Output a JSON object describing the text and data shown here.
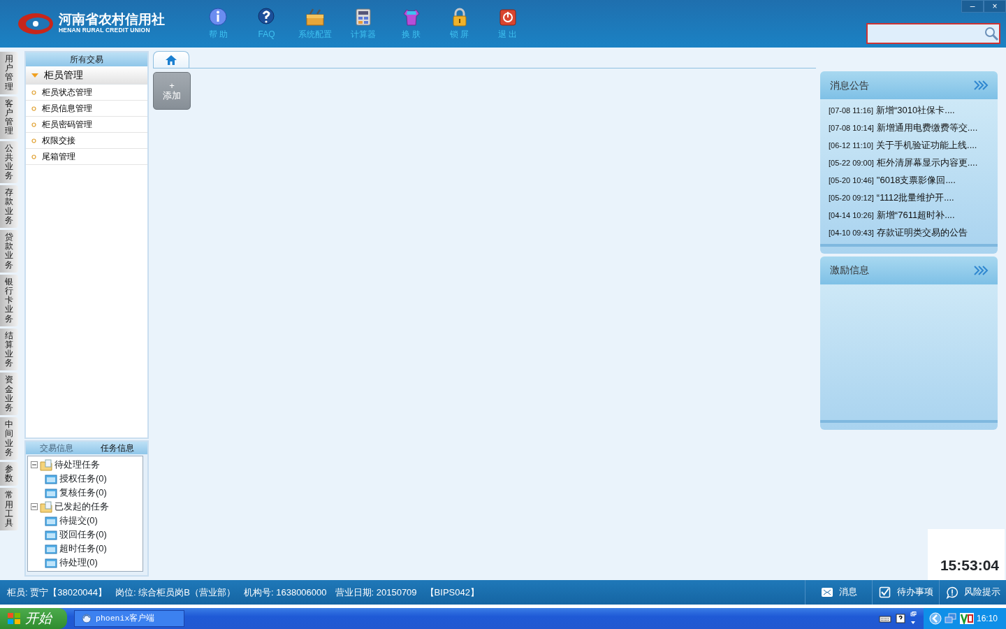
{
  "app": {
    "logo_title": "河南省农村信用社",
    "logo_subtitle": "HENAN RURAL CREDIT UNION"
  },
  "toolbar": [
    {
      "label": "帮 助",
      "kind": "info"
    },
    {
      "label": "FAQ",
      "kind": "question"
    },
    {
      "label": "系统配置",
      "kind": "toolbox"
    },
    {
      "label": "计算器",
      "kind": "calculator"
    },
    {
      "label": "换 肤",
      "kind": "shirt"
    },
    {
      "label": "锁 屏",
      "kind": "lock"
    },
    {
      "label": "退 出",
      "kind": "power"
    }
  ],
  "window_controls": [
    "–",
    "×"
  ],
  "side_tabs": [
    {
      "label": "用户管理"
    },
    {
      "label": "客户管理"
    },
    {
      "label": "公共业务"
    },
    {
      "label": "存款业务"
    },
    {
      "label": "贷款业务"
    },
    {
      "label": "银行卡业务"
    },
    {
      "label": "结算业务"
    },
    {
      "label": "资金业务"
    },
    {
      "label": "中间业务"
    },
    {
      "label": "参数"
    },
    {
      "label": "常用工具"
    }
  ],
  "nav": {
    "title": "所有交易",
    "group": {
      "label": "柜员管理",
      "expanded": true,
      "items": [
        "柜员状态管理",
        "柜员信息管理",
        "柜员密码管理",
        "权限交接",
        "尾箱管理"
      ]
    }
  },
  "info_tabs": [
    {
      "label": "交易信息",
      "selected": false
    },
    {
      "label": "任务信息",
      "selected": true
    }
  ],
  "task_tree": [
    {
      "label": "待处理任务",
      "expanded": true,
      "children": [
        {
          "label": "授权任务(0)"
        },
        {
          "label": "复核任务(0)"
        }
      ]
    },
    {
      "label": "已发起的任务",
      "expanded": true,
      "children": [
        {
          "label": "待提交(0)"
        },
        {
          "label": "驳回任务(0)"
        },
        {
          "label": "超时任务(0)"
        },
        {
          "label": "待处理(0)"
        }
      ]
    }
  ],
  "home_tab": {
    "selected": true
  },
  "add_button": {
    "icon": "+",
    "label": "添加"
  },
  "notices": {
    "title": "消息公告",
    "items": [
      {
        "time": "[07-08 11:16]",
        "text": "新增“3010社保卡...."
      },
      {
        "time": "[07-08 10:14]",
        "text": "新增通用电费缴费等交...."
      },
      {
        "time": "[06-12 11:10]",
        "text": "关于手机验证功能上线...."
      },
      {
        "time": "[05-22 09:00]",
        "text": "柜外清屏幕显示内容更...."
      },
      {
        "time": "[05-20 10:46]",
        "text": "\"6018支票影像回...."
      },
      {
        "time": "[05-20 09:12]",
        "text": "“1112批量维护开...."
      },
      {
        "time": "[04-14 10:26]",
        "text": "新增“7611超时补...."
      },
      {
        "time": "[04-10 09:43]",
        "text": "存款证明类交易的公告"
      }
    ]
  },
  "incentive": {
    "title": "激励信息"
  },
  "clock": "15:53:04",
  "status_fields": [
    "柜员: 贾宁【38020044】",
    "岗位: 综合柜员岗B（营业部）",
    "机构号: 1638006000",
    "营业日期: 20150709",
    "【BIPS042】"
  ],
  "status_buttons": [
    {
      "label": "消息",
      "kind": "mail"
    },
    {
      "label": "待办事项",
      "kind": "check"
    },
    {
      "label": "风险提示",
      "kind": "alert"
    }
  ],
  "taskbar": {
    "start": "开始",
    "tasks": [
      {
        "label": "phoenix客户端",
        "selected": false
      }
    ],
    "time": "16:10"
  }
}
